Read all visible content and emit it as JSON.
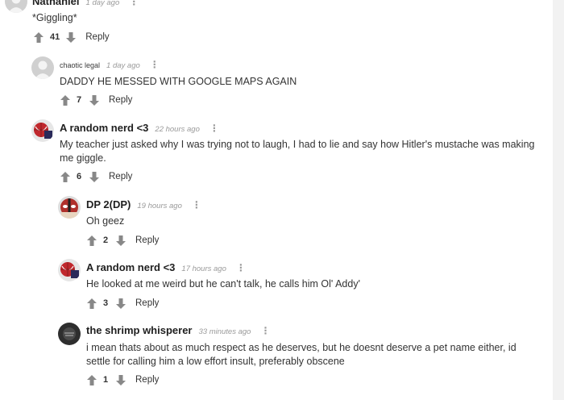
{
  "colors": {
    "arrow": "#888888",
    "avatar_default": "#c8c8c8"
  },
  "comments": [
    {
      "author": "Nathaniel",
      "time": "1 day ago",
      "text": "*Giggling*",
      "score": "41",
      "reply": "Reply",
      "avatar": "default-avatar"
    },
    {
      "author": "chaotic legal",
      "time": "1 day ago",
      "text": "DADDY HE MESSED WITH GOOGLE MAPS AGAIN",
      "score": "7",
      "reply": "Reply",
      "avatar": "default-avatar"
    },
    {
      "author": "A random nerd <3",
      "time": "22 hours ago",
      "text": "My teacher just asked why I was trying not to laugh, I had to lie and say how Hitler's mustache was making me giggle.",
      "score": "6",
      "reply": "Reply",
      "avatar": "spiderman-avatar"
    },
    {
      "author": "DP 2(DP)",
      "time": "19 hours ago",
      "text": "Oh geez",
      "score": "2",
      "reply": "Reply",
      "avatar": "deadpool-avatar"
    },
    {
      "author": "A random nerd <3",
      "time": "17 hours ago",
      "text": "He looked at me weird but he can't talk, he calls him Ol' Addy'",
      "score": "3",
      "reply": "Reply",
      "avatar": "spiderman-avatar"
    },
    {
      "author": "the shrimp whisperer",
      "time": "33 minutes ago",
      "text": "i mean thats about as much respect as he deserves, but he doesnt deserve a pet name either, id settle for calling him a low effort insult, preferably obscene",
      "score": "1",
      "reply": "Reply",
      "avatar": "shrimp-avatar"
    }
  ]
}
